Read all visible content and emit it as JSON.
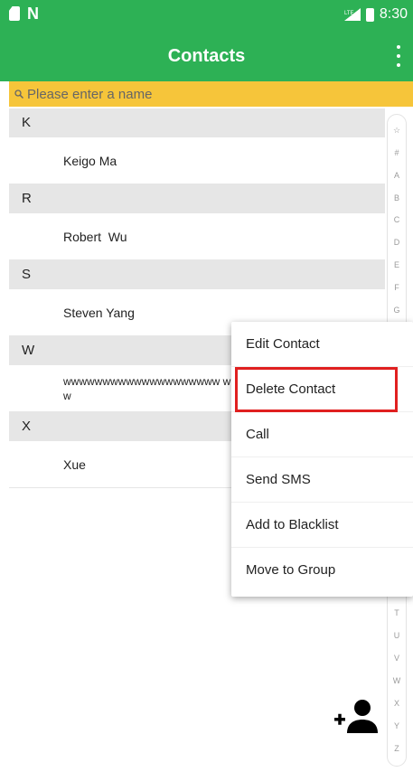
{
  "status_bar": {
    "time": "8:30",
    "network_label": "LTE"
  },
  "app_bar": {
    "title": "Contacts"
  },
  "search": {
    "placeholder": "Please enter a name"
  },
  "sections": [
    {
      "letter": "K",
      "contacts": [
        "Keigo Ma"
      ]
    },
    {
      "letter": "R",
      "contacts": [
        "Robert  Wu"
      ]
    },
    {
      "letter": "S",
      "contacts": [
        "Steven Yang"
      ]
    },
    {
      "letter": "W",
      "contacts": [
        "wwwwwwwwwwwwwwwwwwww ww"
      ]
    },
    {
      "letter": "X",
      "contacts": [
        "Xue"
      ]
    }
  ],
  "index_letters": [
    "☆",
    "#",
    "A",
    "B",
    "C",
    "D",
    "E",
    "F",
    "G",
    "T",
    "U",
    "V",
    "W",
    "X",
    "Y",
    "Z"
  ],
  "context_menu": {
    "items": [
      "Edit Contact",
      "Delete Contact",
      "Call",
      "Send SMS",
      "Add to Blacklist",
      "Move to Group"
    ],
    "highlighted": "Delete Contact"
  },
  "colors": {
    "app_bar": "#2db155",
    "search_bar": "#f6c53a",
    "highlight": "#e02020",
    "section_header": "#e6e6e6"
  },
  "icons": {
    "add_contact": "add-contact-icon",
    "search": "search-icon",
    "overflow": "overflow-menu-icon"
  }
}
